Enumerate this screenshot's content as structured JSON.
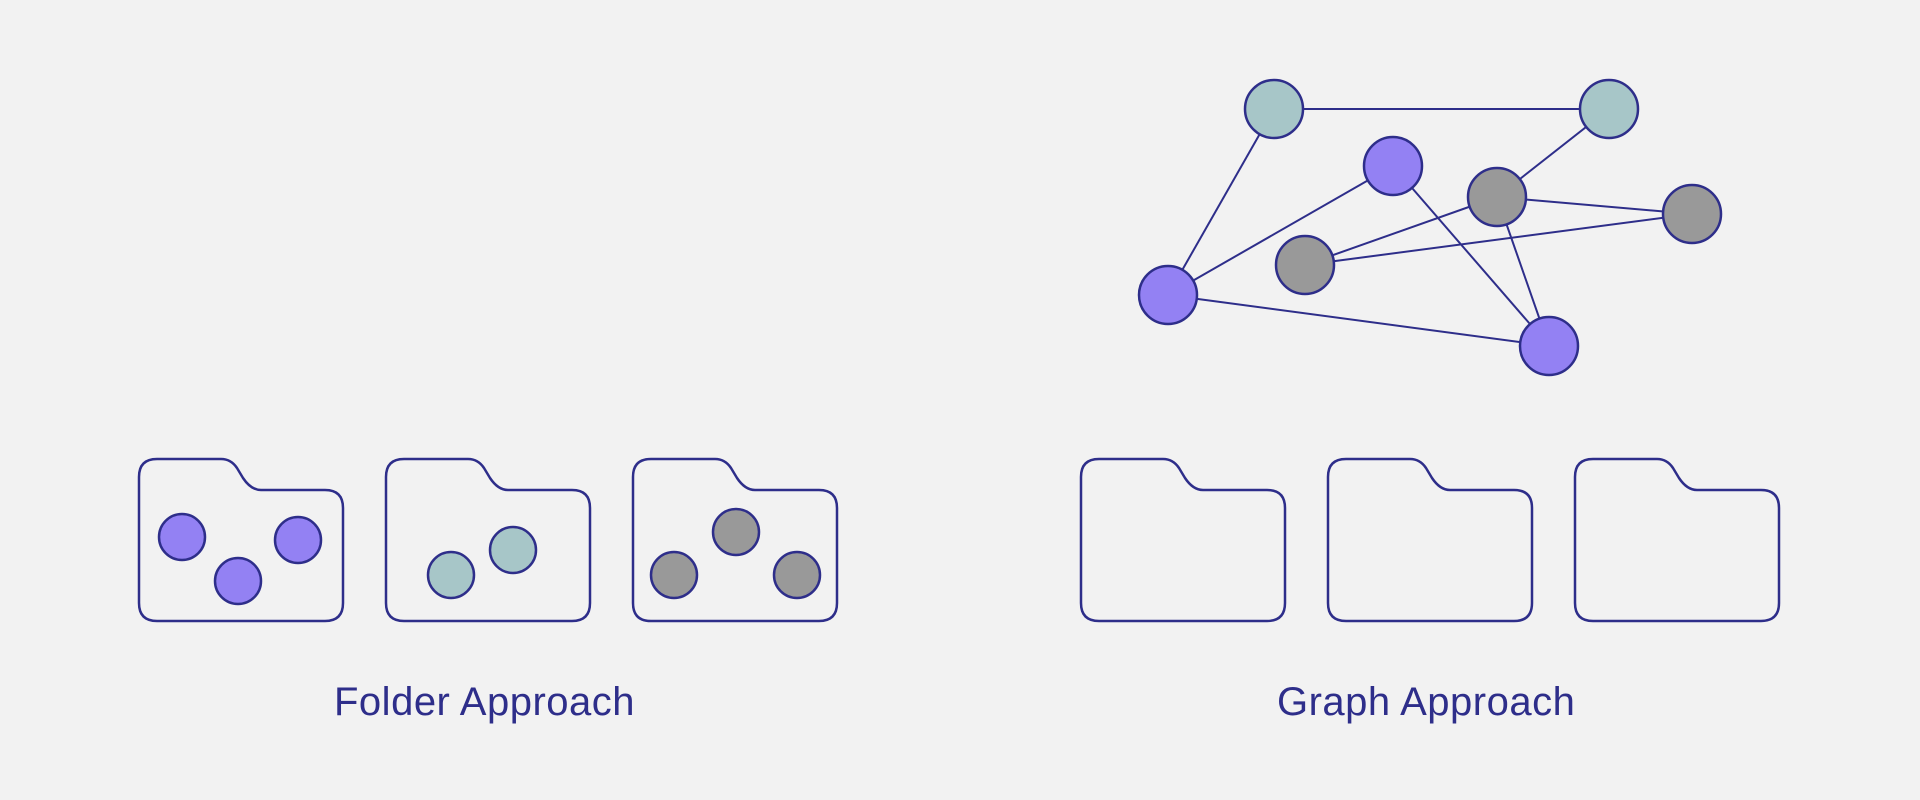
{
  "colors": {
    "stroke": "#2e2e8a",
    "background": "#f2f2f2",
    "purple": "#9381f3",
    "teal": "#a7c6c8",
    "gray": "#999999"
  },
  "left_panel": {
    "caption": "Folder Approach",
    "folders": [
      {
        "name": "folder-purple",
        "items": [
          "purple",
          "purple",
          "purple"
        ]
      },
      {
        "name": "folder-teal",
        "items": [
          "teal",
          "teal"
        ]
      },
      {
        "name": "folder-gray",
        "items": [
          "gray",
          "gray",
          "gray"
        ]
      }
    ]
  },
  "right_panel": {
    "caption": "Graph Approach",
    "folders": [
      {
        "name": "folder-empty-1",
        "items": []
      },
      {
        "name": "folder-empty-2",
        "items": []
      },
      {
        "name": "folder-empty-3",
        "items": []
      }
    ],
    "graph": {
      "nodes": [
        {
          "id": "t1",
          "color": "teal"
        },
        {
          "id": "t2",
          "color": "teal"
        },
        {
          "id": "p1",
          "color": "purple"
        },
        {
          "id": "g1",
          "color": "gray"
        },
        {
          "id": "g2",
          "color": "gray"
        },
        {
          "id": "g3",
          "color": "gray"
        },
        {
          "id": "p2",
          "color": "purple"
        },
        {
          "id": "p3",
          "color": "purple"
        }
      ],
      "edges": [
        [
          "t1",
          "t2"
        ],
        [
          "t1",
          "p2"
        ],
        [
          "t2",
          "g1"
        ],
        [
          "p1",
          "p2"
        ],
        [
          "p1",
          "p3"
        ],
        [
          "g1",
          "g2"
        ],
        [
          "g1",
          "g3"
        ],
        [
          "g1",
          "p3"
        ],
        [
          "g2",
          "g3"
        ],
        [
          "p2",
          "p3"
        ]
      ]
    }
  }
}
